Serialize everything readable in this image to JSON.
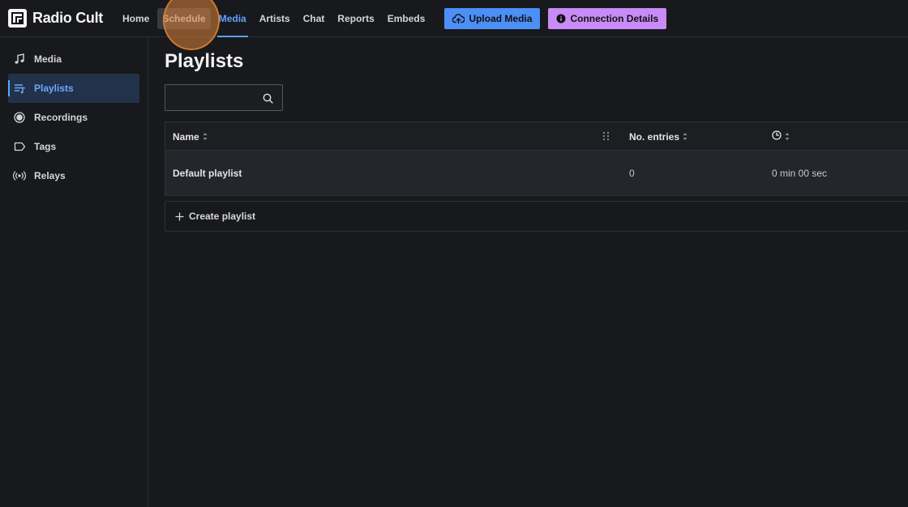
{
  "app": {
    "name": "Radio Cult"
  },
  "nav": {
    "items": [
      {
        "label": "Home"
      },
      {
        "label": "Schedule"
      },
      {
        "label": "Media"
      },
      {
        "label": "Artists"
      },
      {
        "label": "Chat"
      },
      {
        "label": "Reports"
      },
      {
        "label": "Embeds"
      }
    ],
    "active": "Media",
    "hovered": "Schedule"
  },
  "actions": {
    "upload_label": "Upload Media",
    "upload_icon": "cloud-upload-icon",
    "connection_label": "Connection Details",
    "connection_icon": "info-icon"
  },
  "sidebar": {
    "items": [
      {
        "label": "Media",
        "icon": "music-note-icon"
      },
      {
        "label": "Playlists",
        "icon": "playlist-icon"
      },
      {
        "label": "Recordings",
        "icon": "record-icon"
      },
      {
        "label": "Tags",
        "icon": "tag-icon"
      },
      {
        "label": "Relays",
        "icon": "broadcast-icon"
      }
    ],
    "active": "Playlists"
  },
  "main": {
    "title": "Playlists",
    "search": {
      "value": "",
      "placeholder": ""
    },
    "table": {
      "columns": [
        {
          "label": "Name"
        },
        {
          "label": "No. entries"
        },
        {
          "label": "",
          "icon": "clock-icon"
        }
      ],
      "rows": [
        {
          "name": "Default playlist",
          "entries": "0",
          "duration": "0 min 00 sec"
        }
      ]
    },
    "create_label": "Create playlist"
  },
  "colors": {
    "accent": "#5da2ff",
    "upload_button": "#4b8ff7",
    "connection_button": "#c98bf7",
    "background": "#18191c"
  }
}
